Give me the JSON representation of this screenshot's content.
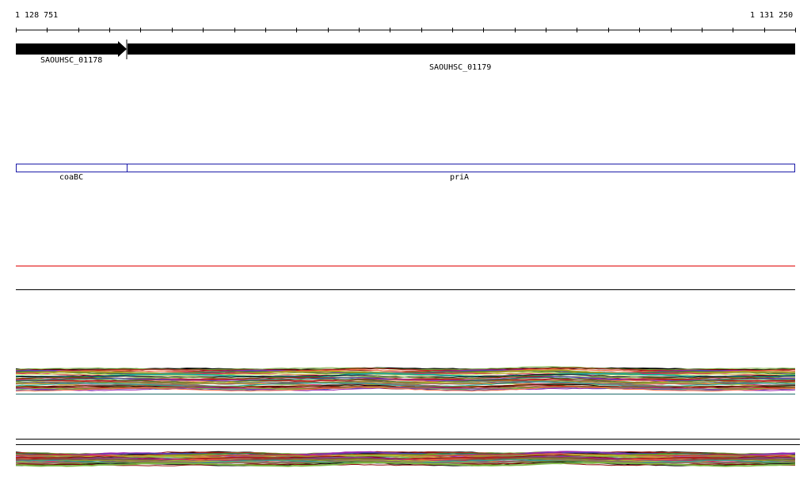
{
  "ruler": {
    "start_label": "1 128 751",
    "end_label": "1 131 250",
    "tick_count": 26
  },
  "genes": [
    {
      "locus": "SAOUHSC_01178",
      "strand": "+"
    },
    {
      "locus": "SAOUHSC_01179",
      "strand": "+"
    }
  ],
  "annotations": [
    {
      "name": "coaBC"
    },
    {
      "name": "priA"
    }
  ],
  "colors": {
    "gene_fill": "#000000",
    "annotation_outline": "#1a1aa8",
    "red_line": "#e00000",
    "black_line": "#000000"
  },
  "coverage_palette": [
    "#000000",
    "#6b8e23",
    "#8b0000",
    "#7cb342",
    "#b22222",
    "#9c27b0",
    "#3f51b5",
    "#ff7043",
    "#2e7d32",
    "#795548",
    "#9e9d24",
    "#d81b60",
    "#607d8b",
    "#c0ca33",
    "#8d6e63",
    "#26a69a"
  ]
}
